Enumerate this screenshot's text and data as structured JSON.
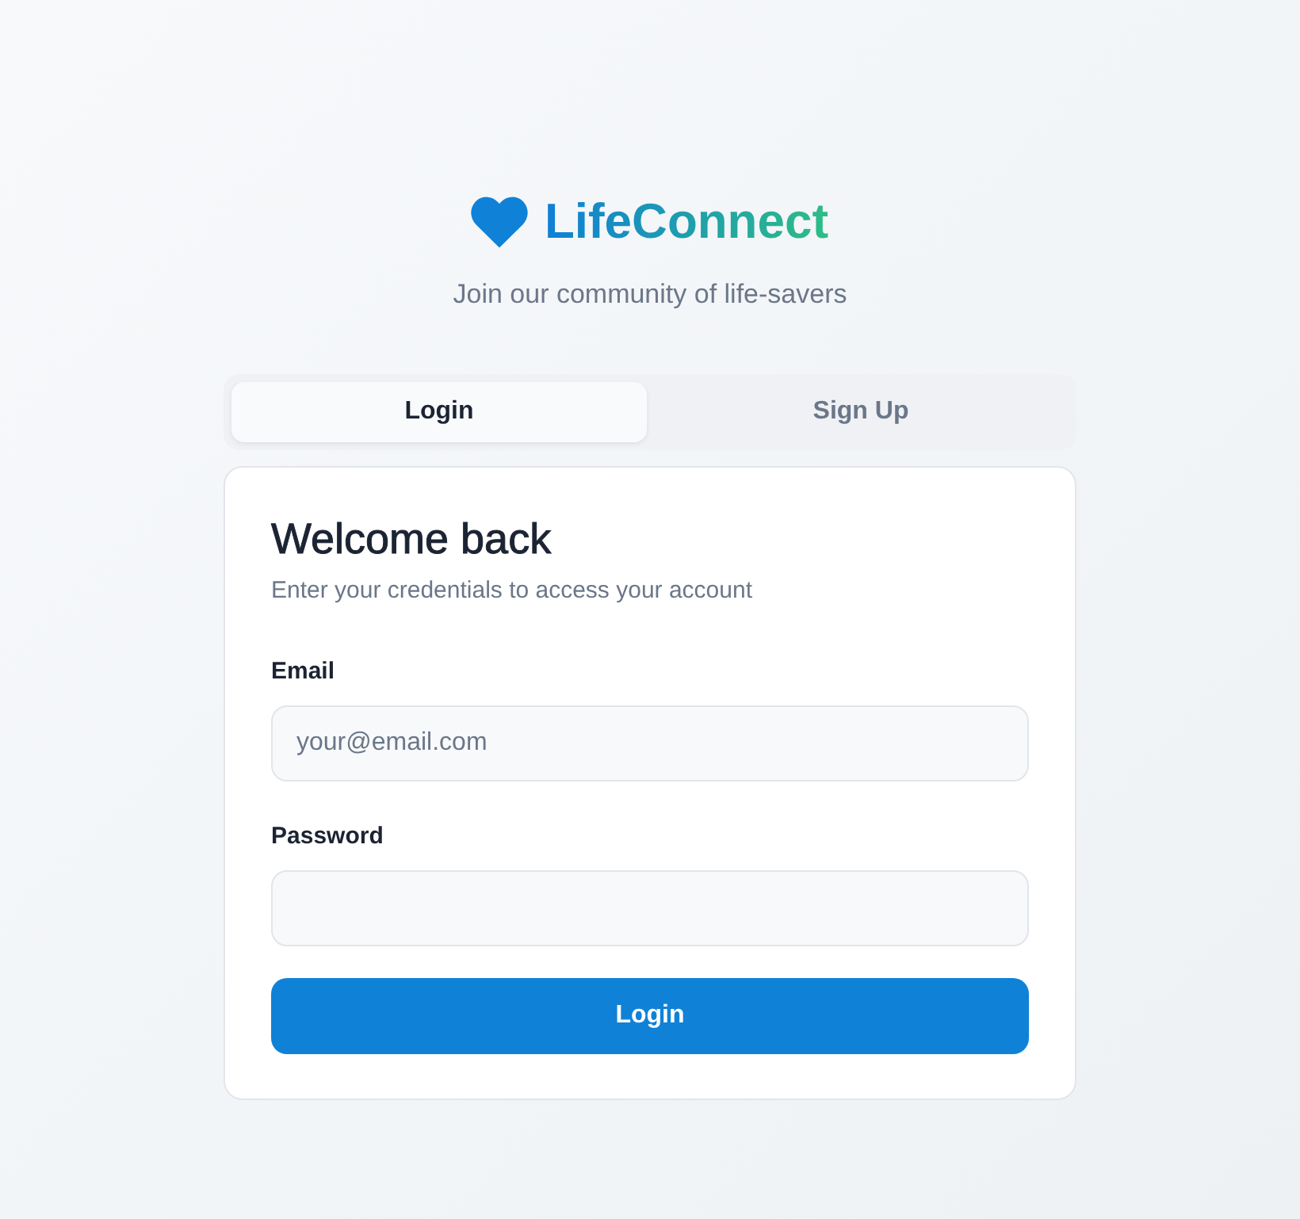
{
  "brand": {
    "name": "LifeConnect",
    "tagline": "Join our community of life-savers"
  },
  "tabs": [
    {
      "label": "Login",
      "selected": true
    },
    {
      "label": "Sign Up",
      "selected": false
    }
  ],
  "card": {
    "title": "Welcome back",
    "subtitle": "Enter your credentials to access your account",
    "fields": [
      {
        "label": "Email",
        "placeholder": "your@email.com"
      },
      {
        "label": "Password"
      }
    ],
    "submit": "Login"
  }
}
